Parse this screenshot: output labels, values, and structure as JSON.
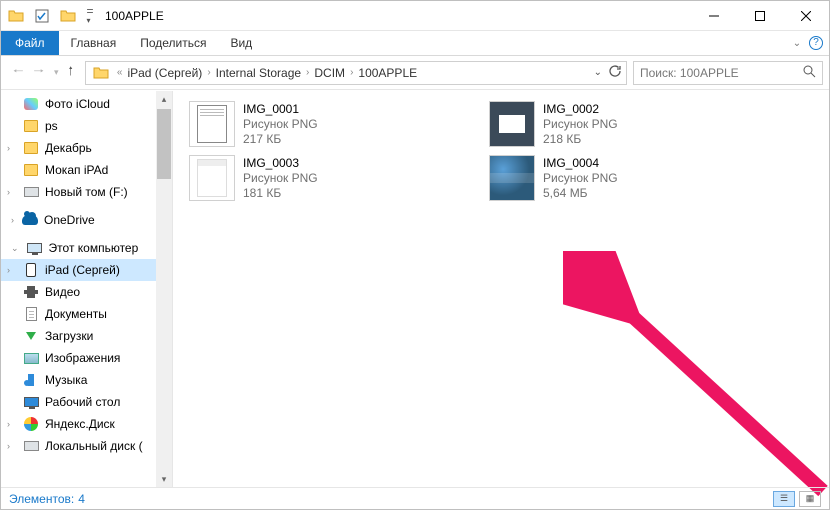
{
  "titlebar": {
    "title": "100APPLE"
  },
  "ribbon": {
    "file": "Файл",
    "tabs": [
      "Главная",
      "Поделиться",
      "Вид"
    ]
  },
  "address": {
    "crumbs": [
      "iPad (Сергей)",
      "Internal Storage",
      "DCIM",
      "100APPLE"
    ]
  },
  "search": {
    "placeholder": "Поиск: 100APPLE"
  },
  "nav": {
    "items": [
      {
        "label": "Фото iCloud",
        "icon": "photo"
      },
      {
        "label": "ps",
        "icon": "folder"
      },
      {
        "label": "Декабрь",
        "icon": "folder-star"
      },
      {
        "label": "Мокап iPAd",
        "icon": "folder"
      },
      {
        "label": "Новый том (F:)",
        "icon": "drive"
      }
    ],
    "onedrive": {
      "label": "OneDrive"
    },
    "thispc": {
      "label": "Этот компьютер"
    },
    "thispc_children": [
      {
        "label": "iPad (Сергей)",
        "icon": "ipad",
        "selected": true
      },
      {
        "label": "Видео",
        "icon": "film"
      },
      {
        "label": "Документы",
        "icon": "doc"
      },
      {
        "label": "Загрузки",
        "icon": "download"
      },
      {
        "label": "Изображения",
        "icon": "pic"
      },
      {
        "label": "Музыка",
        "icon": "note"
      },
      {
        "label": "Рабочий стол",
        "icon": "desktop"
      },
      {
        "label": "Яндекс.Диск",
        "icon": "disk"
      },
      {
        "label": "Локальный диск (",
        "icon": "drive"
      }
    ]
  },
  "files": [
    {
      "name": "IMG_0001",
      "type": "Рисунок PNG",
      "size": "217 КБ",
      "thumb": "white"
    },
    {
      "name": "IMG_0002",
      "type": "Рисунок PNG",
      "size": "218 КБ",
      "thumb": "dark"
    },
    {
      "name": "IMG_0003",
      "type": "Рисунок PNG",
      "size": "181 КБ",
      "thumb": "white"
    },
    {
      "name": "IMG_0004",
      "type": "Рисунок PNG",
      "size": "5,64 МБ",
      "thumb": "home"
    }
  ],
  "status": {
    "label": "Элементов:",
    "count": "4"
  }
}
